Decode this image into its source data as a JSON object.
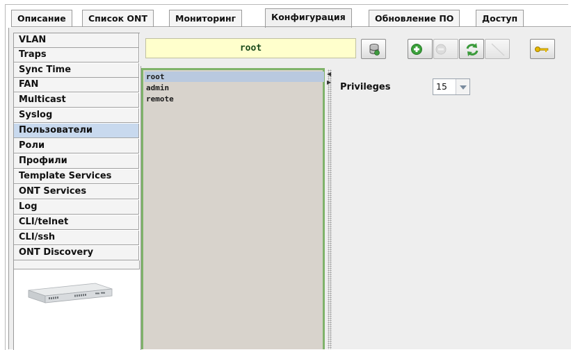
{
  "tabs": [
    {
      "label": "Описание"
    },
    {
      "label": "Список ONT"
    },
    {
      "label": "Мониторинг"
    },
    {
      "label": "Конфигурация",
      "active": true
    },
    {
      "label": "Обновление ПО"
    },
    {
      "label": "Доступ"
    }
  ],
  "sidebar": {
    "items": [
      {
        "label": "VLAN"
      },
      {
        "label": "Traps"
      },
      {
        "label": "Sync Time"
      },
      {
        "label": "FAN"
      },
      {
        "label": "Multicast"
      },
      {
        "label": "Syslog"
      },
      {
        "label": "Пользователи",
        "selected": true
      },
      {
        "label": "Роли"
      },
      {
        "label": "Профили"
      },
      {
        "label": "Template Services"
      },
      {
        "label": "ONT Services"
      },
      {
        "label": "Log"
      },
      {
        "label": "CLI/telnet"
      },
      {
        "label": "CLI/ssh"
      },
      {
        "label": "ONT Discovery"
      }
    ]
  },
  "toolbar": {
    "current_name": "root",
    "buttons": [
      {
        "icon": "database-icon",
        "enabled": true
      },
      {
        "icon": "add-icon",
        "enabled": true
      },
      {
        "icon": "remove-icon",
        "enabled": false
      },
      {
        "icon": "refresh-icon",
        "enabled": true
      },
      {
        "icon": "edit-icon",
        "enabled": false
      },
      {
        "icon": "key-icon",
        "enabled": true
      }
    ]
  },
  "users": {
    "items": [
      "root",
      "admin",
      "remote"
    ],
    "selected": "root"
  },
  "details": {
    "privileges_label": "Privileges",
    "privileges_value": "15"
  },
  "colors": {
    "list_border": "#7fb36a",
    "name_field_bg": "#ffffcc",
    "selection": "#c8d9ee"
  }
}
